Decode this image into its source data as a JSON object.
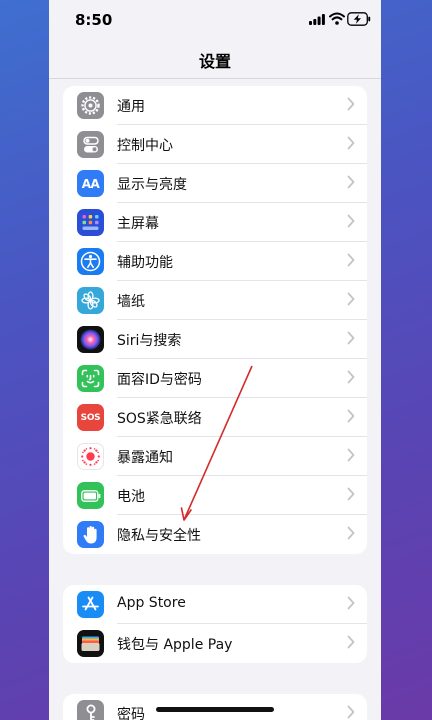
{
  "status_bar": {
    "time": "8:50"
  },
  "header": {
    "title": "设置"
  },
  "groups": [
    {
      "items": [
        {
          "label": "通用",
          "icon": "gear-icon",
          "color": "#8e8e93"
        },
        {
          "label": "控制中心",
          "icon": "toggle-icon",
          "color": "#8e8e93"
        },
        {
          "label": "显示与亮度",
          "icon": "text-size-icon",
          "color": "#2f7cf6",
          "glyph": "AA"
        },
        {
          "label": "主屏幕",
          "icon": "home-grid-icon",
          "color": "#2a4fd6"
        },
        {
          "label": "辅助功能",
          "icon": "accessibility-icon",
          "color": "#1a7cf0"
        },
        {
          "label": "墙纸",
          "icon": "flower-icon",
          "color": "#35a7d9"
        },
        {
          "label": "Siri与搜索",
          "icon": "siri-icon",
          "color": "#111111"
        },
        {
          "label": "面容ID与密码",
          "icon": "face-id-icon",
          "color": "#33c25a"
        },
        {
          "label": "SOS紧急联络",
          "icon": "sos-icon",
          "color": "#e8453c",
          "glyph": "SOS"
        },
        {
          "label": "暴露通知",
          "icon": "exposure-icon",
          "color": "#ffffff"
        },
        {
          "label": "电池",
          "icon": "battery-icon",
          "color": "#33c25a"
        },
        {
          "label": "隐私与安全性",
          "icon": "hand-icon",
          "color": "#2f7cf6"
        }
      ]
    },
    {
      "items": [
        {
          "label": "App Store",
          "icon": "app-store-icon",
          "color": "#1a8cf5"
        },
        {
          "label": "钱包与 Apple Pay",
          "icon": "wallet-icon",
          "color": "#111111"
        }
      ]
    },
    {
      "items": [
        {
          "label": "密码",
          "icon": "key-icon",
          "color": "#8e8e93"
        }
      ]
    }
  ]
}
